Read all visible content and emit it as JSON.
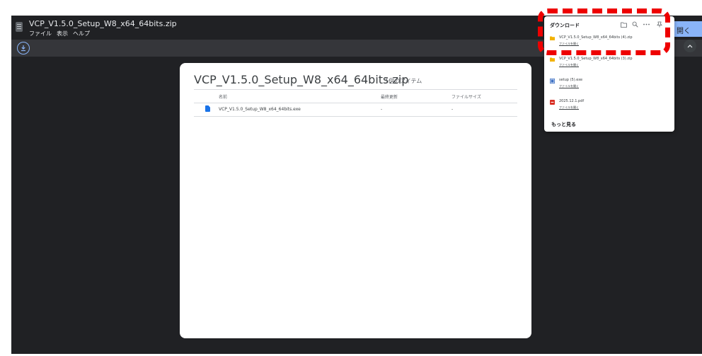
{
  "window": {
    "title": "VCP_V1.5.0_Setup_W8_x64_64bits.zip",
    "menu": [
      "ファイル",
      "表示",
      "ヘルプ"
    ],
    "open_button_label": "開く",
    "icons": [
      "archive-app-icon",
      "download-icon",
      "chevron-up-icon"
    ]
  },
  "archive": {
    "title": "VCP_V1.5.0_Setup_W8_x64_64bits.zip",
    "item_count": "1個のアイテム",
    "columns": [
      "名前",
      "最終更新",
      "ファイルサイズ"
    ],
    "rows": [
      {
        "name": "VCP_V1.5.0_Setup_W8_x64_64bits.exe",
        "modified": "-",
        "size": "-",
        "icon": "file-icon"
      }
    ]
  },
  "downloads": {
    "title": "ダウンロード",
    "icons": [
      "folder-icon",
      "search-icon",
      "more-icon",
      "pin-icon"
    ],
    "items": [
      {
        "name": "VCP_V1.5.0_Setup_W8_x64_64bits (4).zip",
        "action": "ファイルを開く",
        "icon": "zip-icon"
      },
      {
        "name": "VCP_V1.5.0_Setup_W8_x64_64bits (3).zip",
        "action": "ファイルを開く",
        "icon": "zip-icon"
      },
      {
        "name": "setup (5).exe",
        "action": "ファイルを開く",
        "icon": "exe-icon"
      },
      {
        "name": "2025.12.1.pdf",
        "action": "ファイルを開く",
        "icon": "pdf-icon"
      }
    ],
    "more_label": "もっと見る"
  },
  "colors": {
    "app_background": "#202124",
    "accent_blue": "#8ab4f8",
    "highlight_red": "#ee0000",
    "zip_yellow": "#f2b200",
    "pdf_red": "#d93025"
  }
}
